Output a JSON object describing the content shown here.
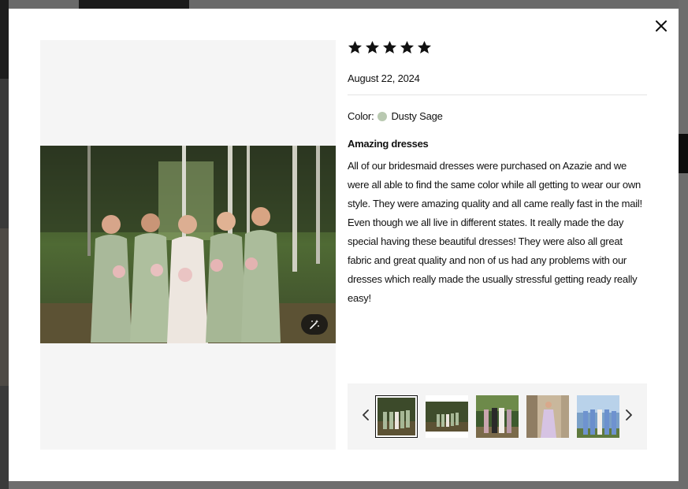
{
  "modal": {
    "close_label": "×",
    "rating": 5,
    "date": "August 22, 2024",
    "color_label": "Color:",
    "color_name": "Dusty Sage",
    "color_swatch": "#b9c9b1",
    "review_title": "Amazing dresses",
    "review_body": "All of our bridesmaid dresses were purchased on Azazie and we were all able to find the same color while all getting to wear our own style. They were amazing quality and all came really fast in the mail! Even though we all live in different states. It really made the day special having these beautiful dresses! They were also all great fabric and great quality and non of us had any problems with our dresses which really made the usually stressful getting ready really easy!",
    "thumbnails": [
      {
        "name": "thumbnail-1",
        "active": true
      },
      {
        "name": "thumbnail-2",
        "active": false
      },
      {
        "name": "thumbnail-3",
        "active": false
      },
      {
        "name": "thumbnail-4",
        "active": false
      },
      {
        "name": "thumbnail-5",
        "active": false
      }
    ],
    "icons": {
      "close": "close-icon",
      "star": "star-icon",
      "prev": "chevron-left-icon",
      "next": "chevron-right-icon",
      "enhance": "magic-wand-icon"
    }
  }
}
